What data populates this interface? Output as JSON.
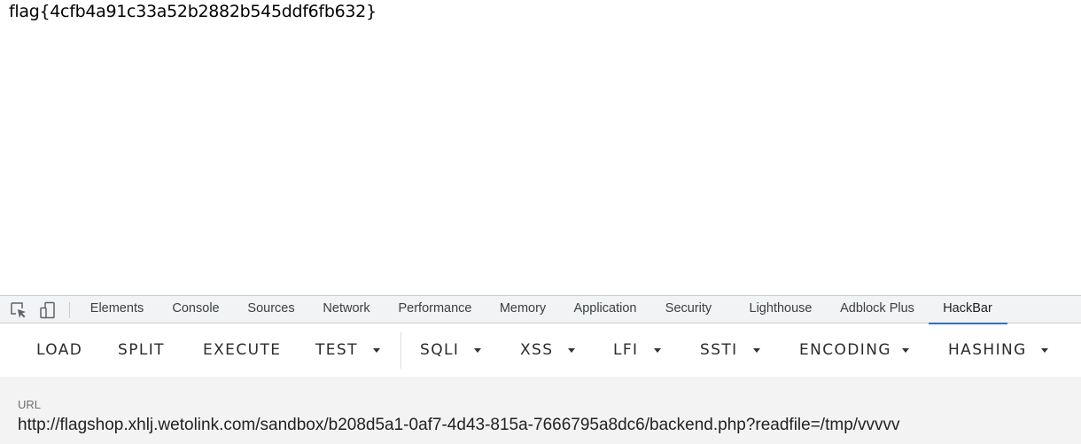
{
  "page": {
    "flag": "flag{4cfb4a91c33a52b2882b545ddf6fb632}"
  },
  "devtools": {
    "icons": [
      "inspect-element-icon",
      "device-toolbar-icon"
    ],
    "tabs": [
      {
        "label": "Elements"
      },
      {
        "label": "Console"
      },
      {
        "label": "Sources"
      },
      {
        "label": "Network"
      },
      {
        "label": "Performance"
      },
      {
        "label": "Memory"
      },
      {
        "label": "Application"
      },
      {
        "label": "Security"
      },
      {
        "label": "Lighthouse"
      },
      {
        "label": "Adblock Plus"
      },
      {
        "label": "HackBar"
      }
    ],
    "active_tab": "HackBar",
    "accent_color": "#1a73e8"
  },
  "hackbar": {
    "buttons": [
      {
        "label": "LOAD",
        "dropdown": false
      },
      {
        "label": "SPLIT",
        "dropdown": false
      },
      {
        "label": "EXECUTE",
        "dropdown": false
      },
      {
        "label": "TEST",
        "dropdown": true
      },
      {
        "label": "SQLI",
        "dropdown": true
      },
      {
        "label": "XSS",
        "dropdown": true
      },
      {
        "label": "LFI",
        "dropdown": true
      },
      {
        "label": "SSTI",
        "dropdown": true
      },
      {
        "label": "ENCODING",
        "dropdown": true
      },
      {
        "label": "HASHING",
        "dropdown": true
      }
    ],
    "url_label": "URL",
    "url_value": "http://flagshop.xhlj.wetolink.com/sandbox/b208d5a1-0af7-4d43-815a-7666795a8dc6/backend.php?readfile=/tmp/vvvvv"
  }
}
